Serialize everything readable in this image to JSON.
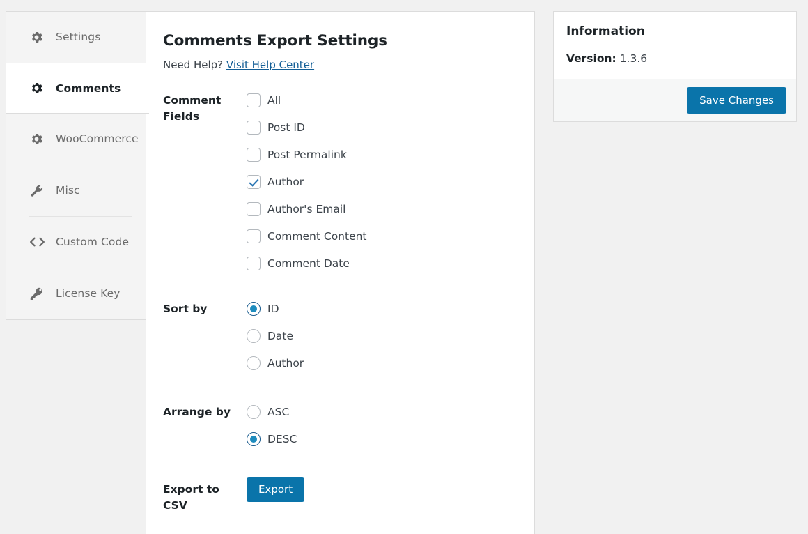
{
  "sidebar": {
    "items": [
      {
        "label": "Settings",
        "icon": "gear-icon",
        "active": false
      },
      {
        "label": "Comments",
        "icon": "gear-icon",
        "active": true
      },
      {
        "label": "WooCommerce",
        "icon": "gear-icon",
        "active": false
      },
      {
        "label": "Misc",
        "icon": "wrench-icon",
        "active": false
      },
      {
        "label": "Custom Code",
        "icon": "code-icon",
        "active": false
      },
      {
        "label": "License Key",
        "icon": "key-icon",
        "active": false
      }
    ]
  },
  "main": {
    "title": "Comments Export Settings",
    "help_prefix": "Need Help? ",
    "help_link": "Visit Help Center",
    "comment_fields": {
      "label": "Comment Fields",
      "options": [
        {
          "label": "All",
          "checked": false
        },
        {
          "label": "Post ID",
          "checked": false
        },
        {
          "label": "Post Permalink",
          "checked": false
        },
        {
          "label": "Author",
          "checked": true
        },
        {
          "label": "Author's Email",
          "checked": false
        },
        {
          "label": "Comment Content",
          "checked": false
        },
        {
          "label": "Comment Date",
          "checked": false
        }
      ]
    },
    "sort_by": {
      "label": "Sort by",
      "options": [
        {
          "label": "ID",
          "selected": true
        },
        {
          "label": "Date",
          "selected": false
        },
        {
          "label": "Author",
          "selected": false
        }
      ]
    },
    "arrange_by": {
      "label": "Arrange by",
      "options": [
        {
          "label": "ASC",
          "selected": false
        },
        {
          "label": "DESC",
          "selected": true
        }
      ]
    },
    "export": {
      "label": "Export to CSV",
      "button": "Export"
    }
  },
  "information": {
    "title": "Information",
    "version_label": "Version:",
    "version_value": "1.3.6",
    "save_button": "Save Changes"
  },
  "colors": {
    "accent": "#0a74aa",
    "link": "#135e96",
    "radio_dot": "#1e8cbe",
    "check": "#2271b1",
    "page_bg": "#f1f1f1",
    "panel_bg": "#ffffff",
    "sidebar_bg": "#f4f4f4",
    "border": "#dcdcdc"
  }
}
